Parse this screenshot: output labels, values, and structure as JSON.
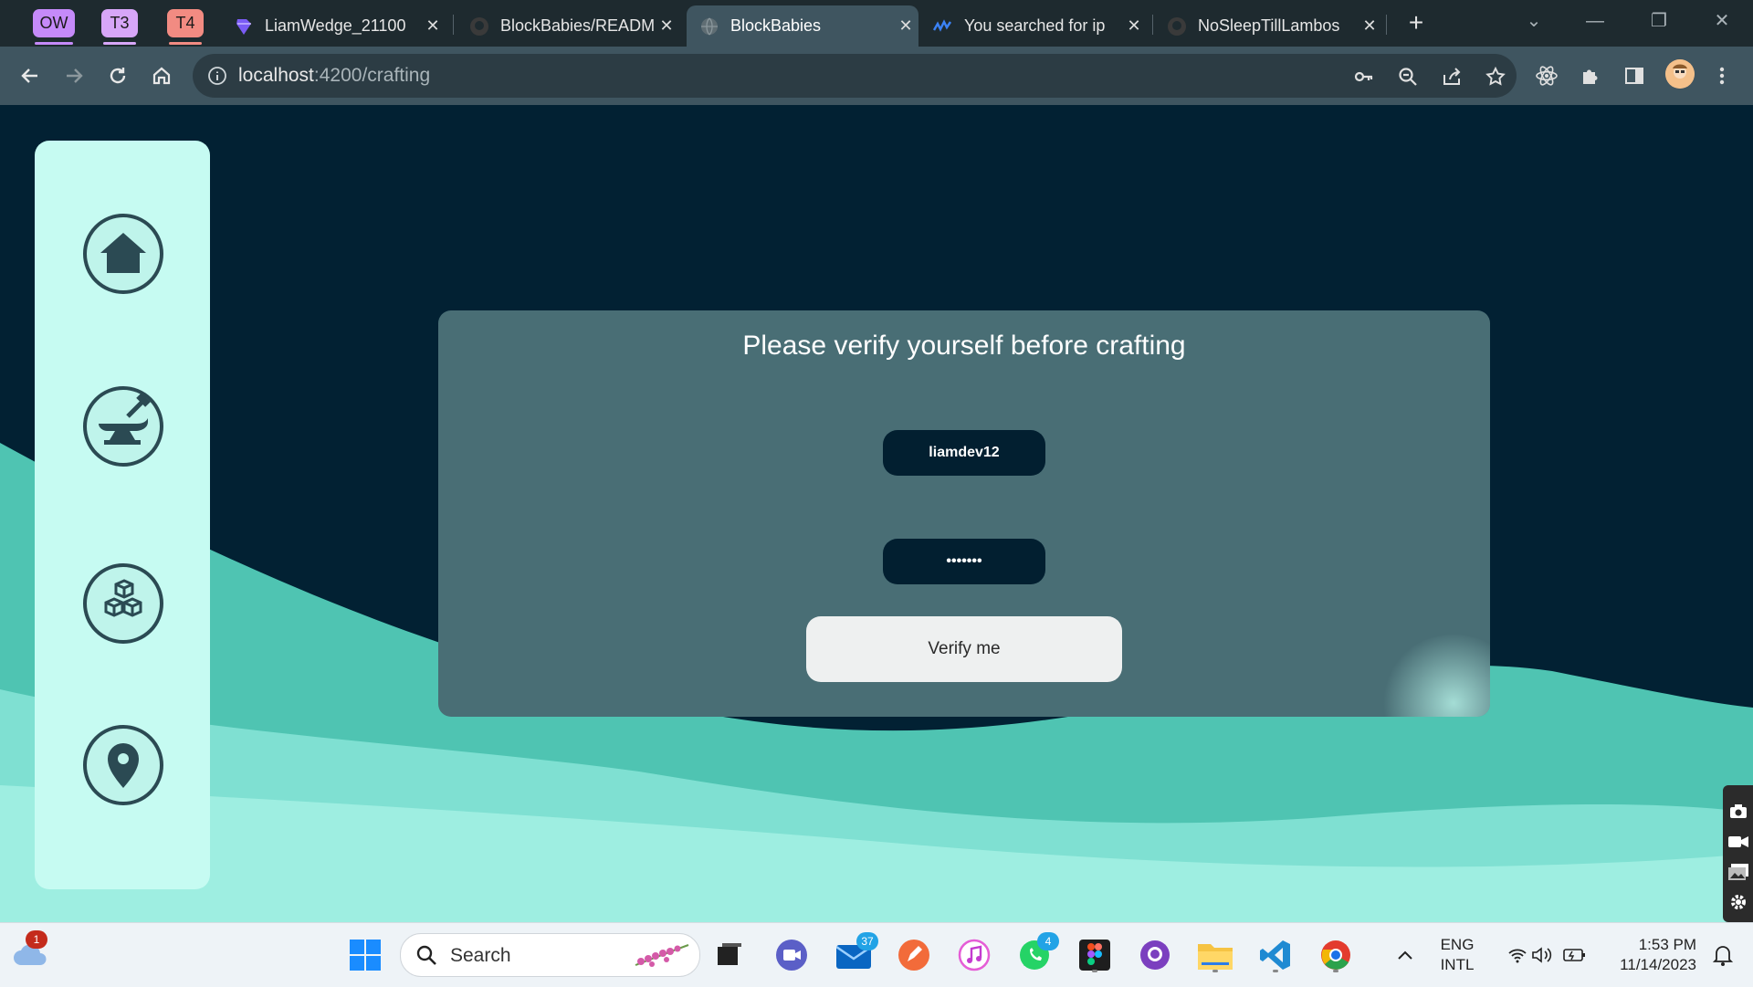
{
  "browser": {
    "tab_groups": [
      {
        "label": "OW",
        "color": "#c58af9",
        "underline": "#c58af9"
      },
      {
        "label": "T3",
        "color": "#d7a6f8",
        "underline": "#d7a6f8"
      },
      {
        "label": "T4",
        "color": "#f28b82",
        "underline": "#f28b82"
      }
    ],
    "tabs": [
      {
        "title": "LiamWedge_21100",
        "icon": "gem-icon",
        "active": false
      },
      {
        "title": "BlockBabies/READM",
        "icon": "github-icon",
        "active": false
      },
      {
        "title": "BlockBabies",
        "icon": "globe-icon",
        "active": true
      },
      {
        "title": "You searched for ip",
        "icon": "wave-logo-icon",
        "active": false
      },
      {
        "title": "NoSleepTillLambos",
        "icon": "github-icon",
        "active": false
      }
    ],
    "new_tab_label": "+",
    "url_host": "localhost",
    "url_rest": ":4200/crafting"
  },
  "page": {
    "heading": "Please verify yourself before crafting",
    "username_value": "liamdev12",
    "password_value": "•••••••",
    "verify_label": "Verify me",
    "nav": [
      "home-icon",
      "anvil-icon",
      "blocks-icon",
      "location-pin-icon"
    ]
  },
  "taskbar": {
    "search_label": "Search",
    "weather_badge": "1",
    "mail_badge": "37",
    "whatsapp_badge": "4",
    "lang_top": "ENG",
    "lang_bottom": "INTL",
    "time": "1:53 PM",
    "date": "11/14/2023"
  },
  "colors": {
    "page_bg": "#022133",
    "card_bg": "#496e75",
    "sidenav_bg": "#c6fbf2",
    "wave_dark": "#4fc4b2",
    "wave_light": "#9eeee1"
  }
}
